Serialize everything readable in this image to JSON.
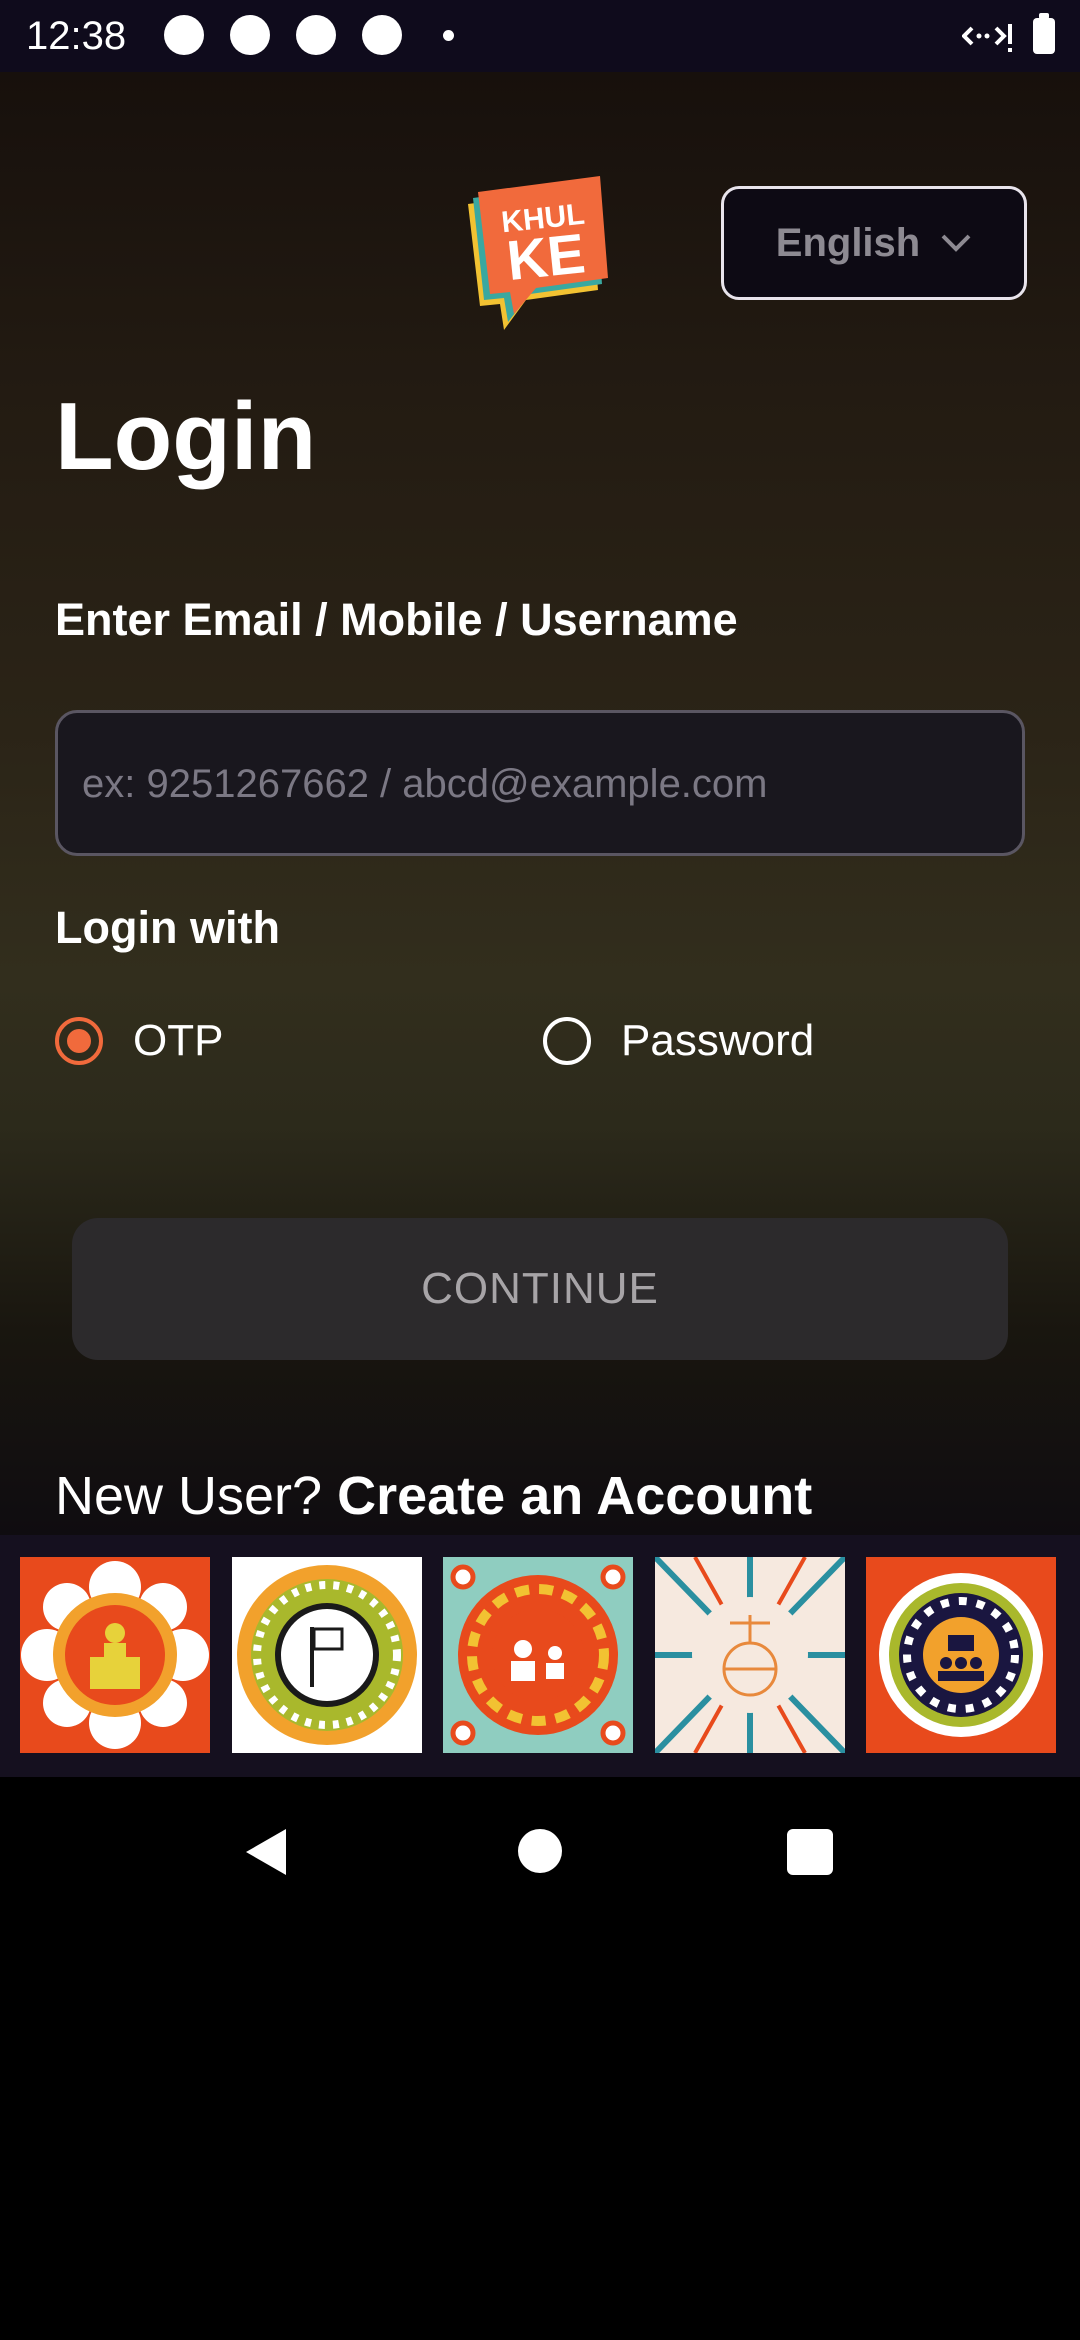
{
  "status_bar": {
    "time": "12:38"
  },
  "header": {
    "language": "English",
    "logo_text_top": "KHUL",
    "logo_text_bottom": "KE"
  },
  "login": {
    "title": "Login",
    "field_label": "Enter Email / Mobile / Username",
    "field_placeholder": "ex: 9251267662 / abcd@example.com",
    "field_value": "",
    "login_with_label": "Login with",
    "options": [
      {
        "label": "OTP",
        "selected": true
      },
      {
        "label": "Password",
        "selected": false
      }
    ],
    "continue_label": "CONTINUE",
    "new_user_prefix": "New User?",
    "create_account_label": "Create an Account"
  },
  "tiles": [
    "leader-podium-icon",
    "flag-icon",
    "debate-people-icon",
    "justice-globe-icon",
    "group-meeting-icon"
  ],
  "colors": {
    "accent": "#f16a3c",
    "background_top": "#17100c",
    "background_mid": "#322e1d",
    "button_disabled": "#2c2a2c"
  }
}
